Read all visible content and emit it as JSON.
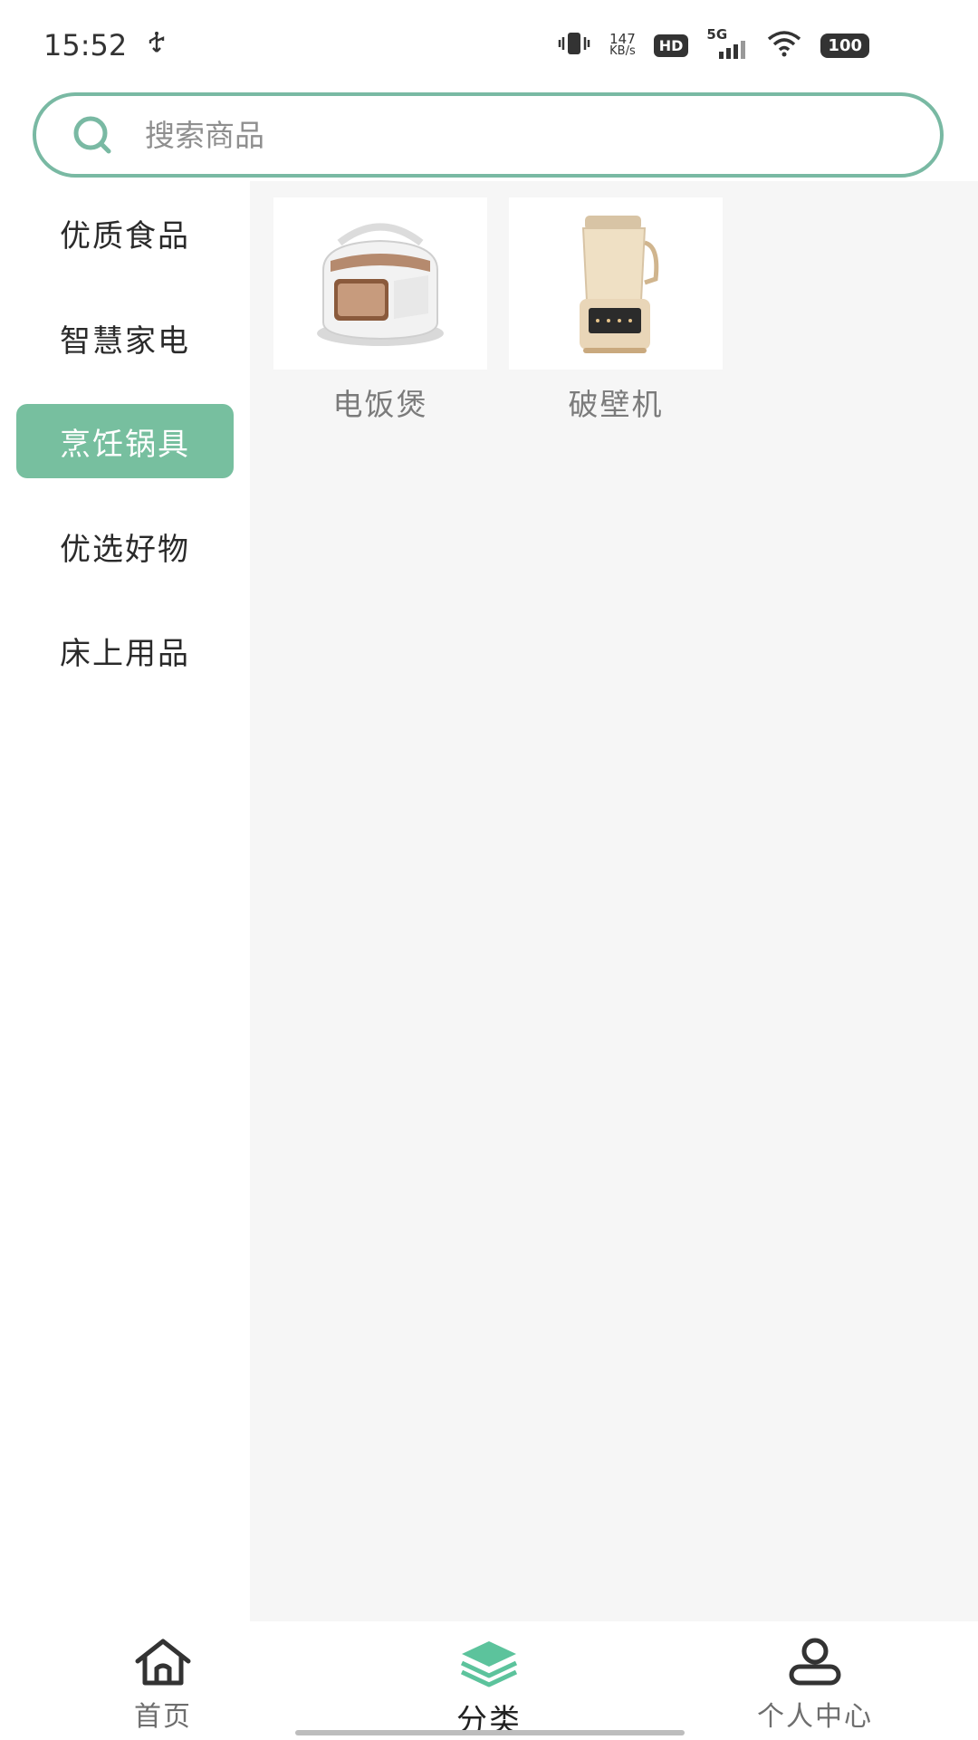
{
  "status_bar": {
    "time": "15:52",
    "network_speed_value": "147",
    "network_speed_unit": "KB/s",
    "hd_label": "HD",
    "network_type": "5G",
    "battery": "100"
  },
  "search": {
    "placeholder": "搜索商品"
  },
  "sidebar": {
    "items": [
      {
        "label": "优质食品"
      },
      {
        "label": "智慧家电"
      },
      {
        "label": "烹饪锅具"
      },
      {
        "label": "优选好物"
      },
      {
        "label": "床上用品"
      }
    ],
    "active_index": 2
  },
  "products": [
    {
      "name": "电饭煲",
      "icon": "rice-cooker-image"
    },
    {
      "name": "破壁机",
      "icon": "blender-image"
    }
  ],
  "bottom_nav": {
    "items": [
      {
        "label": "首页",
        "icon": "home-icon"
      },
      {
        "label": "分类",
        "icon": "category-layers-icon"
      },
      {
        "label": "个人中心",
        "icon": "user-icon"
      }
    ],
    "active_index": 1
  },
  "colors": {
    "accent": "#77bf9f",
    "search_border": "#79b9a3",
    "content_bg": "#f6f6f6"
  }
}
